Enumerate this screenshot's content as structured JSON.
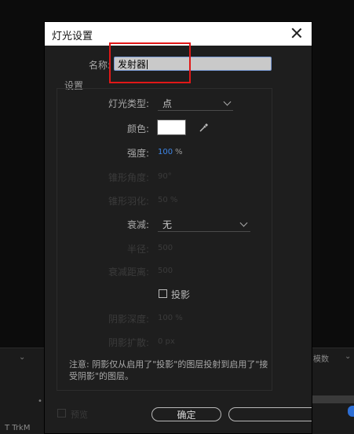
{
  "dialog": {
    "title": "灯光设置",
    "name_label": "名称:",
    "name_value": "发射器",
    "settings_group_label": "设置",
    "light_type_label": "灯光类型:",
    "light_type_value": "点",
    "color_label": "颜色:",
    "color_value": "#ffffff",
    "intensity_label": "强度:",
    "intensity_value": "100",
    "intensity_unit": "%",
    "cone_angle_label": "锥形角度:",
    "cone_angle_value": "90°",
    "cone_feather_label": "锥形羽化:",
    "cone_feather_value": "50 %",
    "falloff_label": "衰减:",
    "falloff_value": "无",
    "radius_label": "半径:",
    "radius_value": "500",
    "falloff_distance_label": "衰减距离:",
    "falloff_distance_value": "500",
    "shadow_checkbox_label": "投影",
    "shadow_darkness_label": "阴影深度:",
    "shadow_darkness_value": "100 %",
    "shadow_diffusion_label": "阴影扩散:",
    "shadow_diffusion_value": "0 px",
    "note": "注意: 阴影仅从启用了\"投影\"的图层投射到启用了\"接受阴影\"的图层。",
    "preview_label": "预览",
    "ok_label": "确定",
    "cancel_label": ""
  },
  "background": {
    "left_panel_text": "T  TrkM",
    "right_panel_text": "模数"
  },
  "colors": {
    "accent": "#3d86e8",
    "highlight": "#e01818",
    "input_focus_border": "#7a9bd6"
  },
  "icons": [
    "close-icon",
    "eyedropper-icon",
    "chevron-down-icon",
    "checkbox-icon"
  ]
}
